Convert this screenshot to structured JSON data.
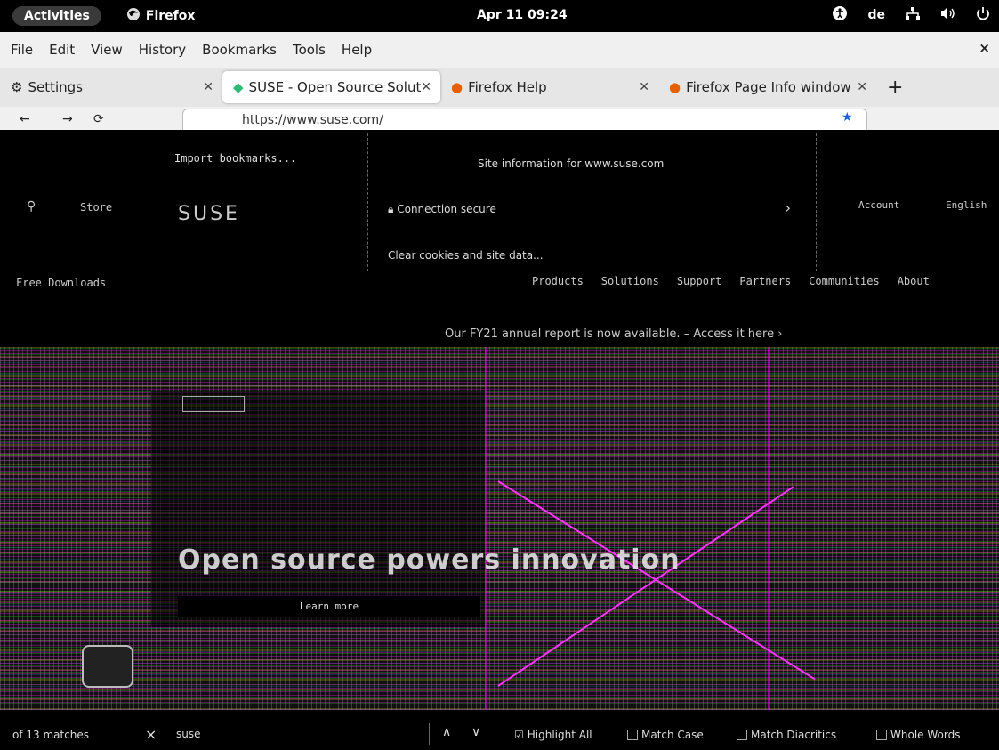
{
  "topbar": {
    "activities": "Activities",
    "app_name": "Firefox",
    "clock": "Apr 11  09:24",
    "keyboard_layout": "de"
  },
  "menubar": {
    "items": [
      "File",
      "Edit",
      "View",
      "History",
      "Bookmarks",
      "Tools",
      "Help"
    ],
    "close": "×"
  },
  "tabs": [
    {
      "label": "Settings",
      "icon": "gear-icon"
    },
    {
      "label": "SUSE - Open Source Solut",
      "icon": "suse-chameleon-icon"
    },
    {
      "label": "Firefox Help",
      "icon": "firefox-icon"
    },
    {
      "label": "Firefox Page Info window",
      "icon": "firefox-icon"
    }
  ],
  "newtab": "+",
  "navbar": {
    "url": "https://www.suse.com/"
  },
  "page": {
    "bookmarks_row": "Import bookmarks...",
    "store": "Store",
    "free_downloads": "Free Downloads",
    "logo": "SUSE",
    "nav": [
      "Products",
      "Solutions",
      "Support",
      "Partners",
      "Communities",
      "About"
    ],
    "account": "Account",
    "language": "English",
    "annual_report": "Our FY21 annual report is now available. – Access it here ›",
    "headline": "Open source powers innovation",
    "learn_more": "Learn more"
  },
  "popup": {
    "title": "Site information for www.suse.com",
    "connection": "Connection secure",
    "clear": "Clear cookies and site data..."
  },
  "findbar": {
    "matches": "of 13 matches",
    "query": "suse",
    "highlight_all": "Highlight All",
    "match_case": "Match Case",
    "match_diacritics": "Match Diacritics",
    "whole_words": "Whole Words"
  }
}
